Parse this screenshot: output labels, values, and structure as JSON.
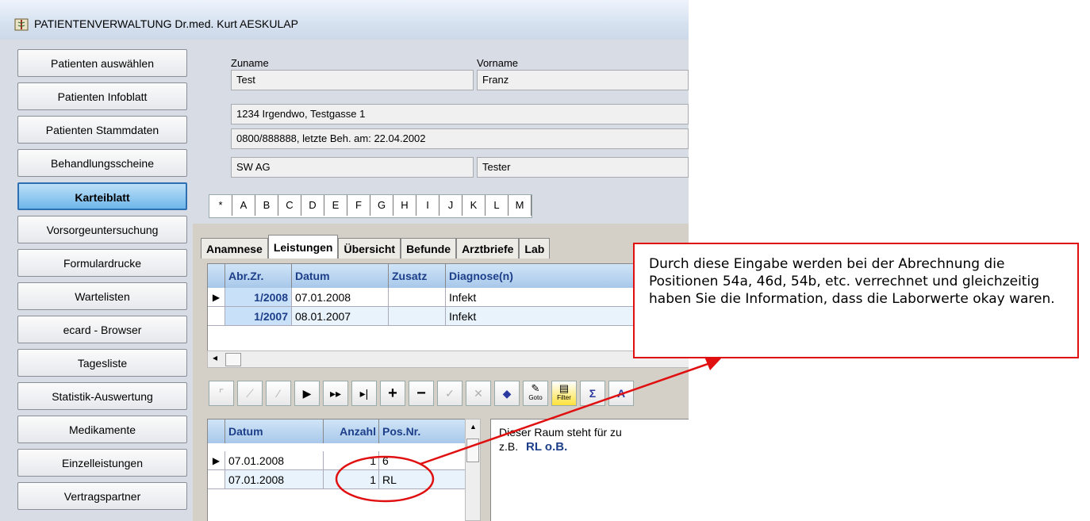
{
  "window": {
    "title": "PATIENTENVERWALTUNG  Dr.med. Kurt AESKULAP",
    "app_icon": "caduceus-app-icon"
  },
  "sidebar": {
    "items": [
      {
        "label": "Patienten auswählen"
      },
      {
        "label": "Patienten Infoblatt"
      },
      {
        "label": "Patienten Stammdaten"
      },
      {
        "label": "Behandlungsscheine"
      },
      {
        "label": "Karteiblatt",
        "active": true
      },
      {
        "label": "Vorsorgeuntersuchung"
      },
      {
        "label": "Formulardrucke"
      },
      {
        "label": "Wartelisten"
      },
      {
        "label": "ecard - Browser"
      },
      {
        "label": "Tagesliste"
      },
      {
        "label": "Statistik-Auswertung"
      },
      {
        "label": "Medikamente"
      },
      {
        "label": "Einzelleistungen"
      },
      {
        "label": "Vertragspartner"
      }
    ]
  },
  "patient": {
    "zuname_label": "Zuname",
    "vorname_label": "Vorname",
    "zuname": "Test",
    "vorname": "Franz",
    "address": "1234  Irgendwo,  Testgasse 1",
    "phone_info": "0800/888888,  letzte Beh. am: 22.04.2002",
    "insurance": "SW AG",
    "extra": "Tester"
  },
  "alphabet": [
    "*",
    "A",
    "B",
    "C",
    "D",
    "E",
    "F",
    "G",
    "H",
    "I",
    "J",
    "K",
    "L",
    "M"
  ],
  "tabs": [
    {
      "label": "Anamnese"
    },
    {
      "label": "Leistungen",
      "active": true
    },
    {
      "label": "Übersicht"
    },
    {
      "label": "Befunde"
    },
    {
      "label": "Arztbriefe"
    },
    {
      "label": "Lab"
    }
  ],
  "scheine_grid": {
    "headers": [
      "Abr.Zr.",
      "Datum",
      "Zusatz",
      "Diagnose(n)"
    ],
    "rows": [
      {
        "abr": "1/2008",
        "datum": "07.01.2008",
        "zusatz": "",
        "diagnose": "Infekt"
      },
      {
        "abr": "1/2007",
        "datum": "08.01.2007",
        "zusatz": "",
        "diagnose": "Infekt"
      }
    ]
  },
  "toolbar": {
    "icons": [
      "first-icon",
      "prior-icon",
      "prev-icon",
      "next-icon",
      "fast-forward-icon",
      "last-icon",
      "plus-icon",
      "minus-icon",
      "edit-icon",
      "cancel-icon",
      "refresh-icon",
      "goto-icon",
      "filter-icon",
      "sum-icon",
      "sort-icon"
    ],
    "goto_label": "Goto",
    "filter_label": "Filter"
  },
  "leistungen_grid": {
    "headers": [
      "Datum",
      "Anzahl",
      "Pos.Nr."
    ],
    "rows": [
      {
        "datum": "07.01.2008",
        "anzahl": "1",
        "pos": "6"
      },
      {
        "datum": "07.01.2008",
        "anzahl": "1",
        "pos": "RL"
      }
    ]
  },
  "note": {
    "line1": "Dieser Raum steht für zu",
    "line2_prefix": "z.B.",
    "line2_highlight": "RL  o.B."
  },
  "callout": {
    "text": "Durch diese Eingabe werden bei der Abrechnung die Positionen 54a, 46d, 54b, etc. verrechnet und gleichzeitig haben Sie die Information, dass die Laborwerte okay waren."
  },
  "colors": {
    "accent": "#2d6fb0",
    "annotation": "#e01010",
    "header_text": "#1d3f8a"
  }
}
